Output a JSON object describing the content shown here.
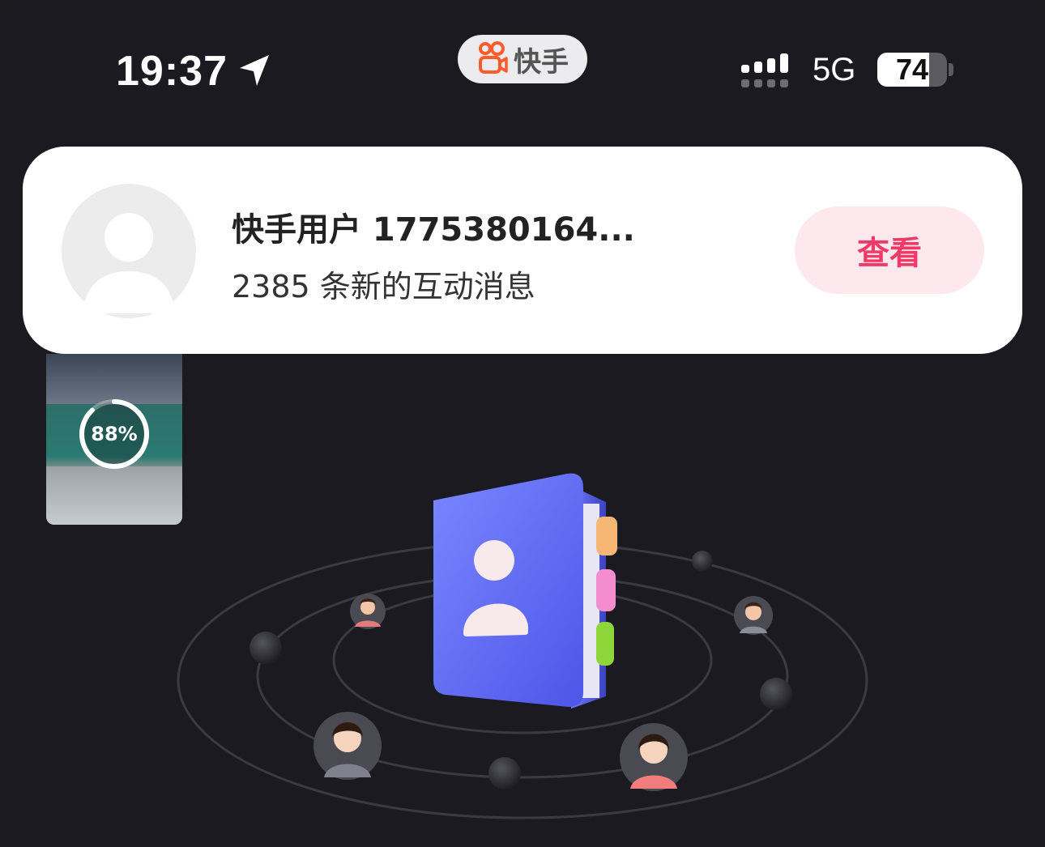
{
  "status_bar": {
    "time": "19:37",
    "network": "5G",
    "battery_level": "74",
    "battery_fraction": 0.74
  },
  "app_pill": {
    "name": "快手"
  },
  "notification": {
    "title": "快手用户 1775380164...",
    "subtitle": "2385 条新的互动消息",
    "action_label": "查看",
    "action_color": "#ef3a68"
  },
  "video_thumbnail": {
    "progress_text": "88%",
    "progress_fraction": 0.88
  },
  "colors": {
    "background": "#1b1a20",
    "accent": "#ef3a68",
    "book_blue": "#5b66f0"
  }
}
